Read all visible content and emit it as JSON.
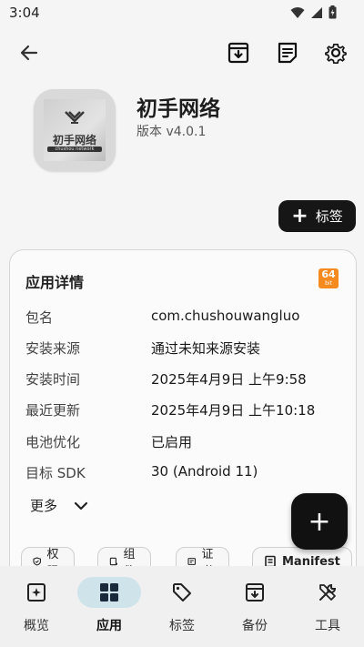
{
  "status": {
    "time": "3:04"
  },
  "app": {
    "name": "初手网络",
    "version": "版本 v4.0.1",
    "icon_text": "初手网络",
    "icon_subtext": "chushou network"
  },
  "tag_button": {
    "label": "标签"
  },
  "details": {
    "title": "应用详情",
    "bit_badge": {
      "number": "64",
      "unit": "bit"
    },
    "rows": [
      {
        "key": "包名",
        "value": "com.chushouwangluo"
      },
      {
        "key": "安装来源",
        "value": "通过未知来源安装"
      },
      {
        "key": "安装时间",
        "value": "2025年4月9日 上午9:58"
      },
      {
        "key": "最近更新",
        "value": "2025年4月9日 上午10:18"
      },
      {
        "key": "电池优化",
        "value": "已启用"
      },
      {
        "key": "目标 SDK",
        "value": "30 (Android 11)"
      }
    ],
    "more_label": "更多",
    "chips": [
      {
        "label": "权限"
      },
      {
        "label": "组件"
      },
      {
        "label": "证书"
      },
      {
        "label": "Manifest"
      }
    ]
  },
  "nav": {
    "items": [
      {
        "label": "概览"
      },
      {
        "label": "应用"
      },
      {
        "label": "标签"
      },
      {
        "label": "备份"
      },
      {
        "label": "工具"
      }
    ],
    "active_index": 1
  },
  "colors": {
    "accent_badge": "#f58a1f",
    "nav_active": "#cfe3ea",
    "dark": "#161616"
  }
}
